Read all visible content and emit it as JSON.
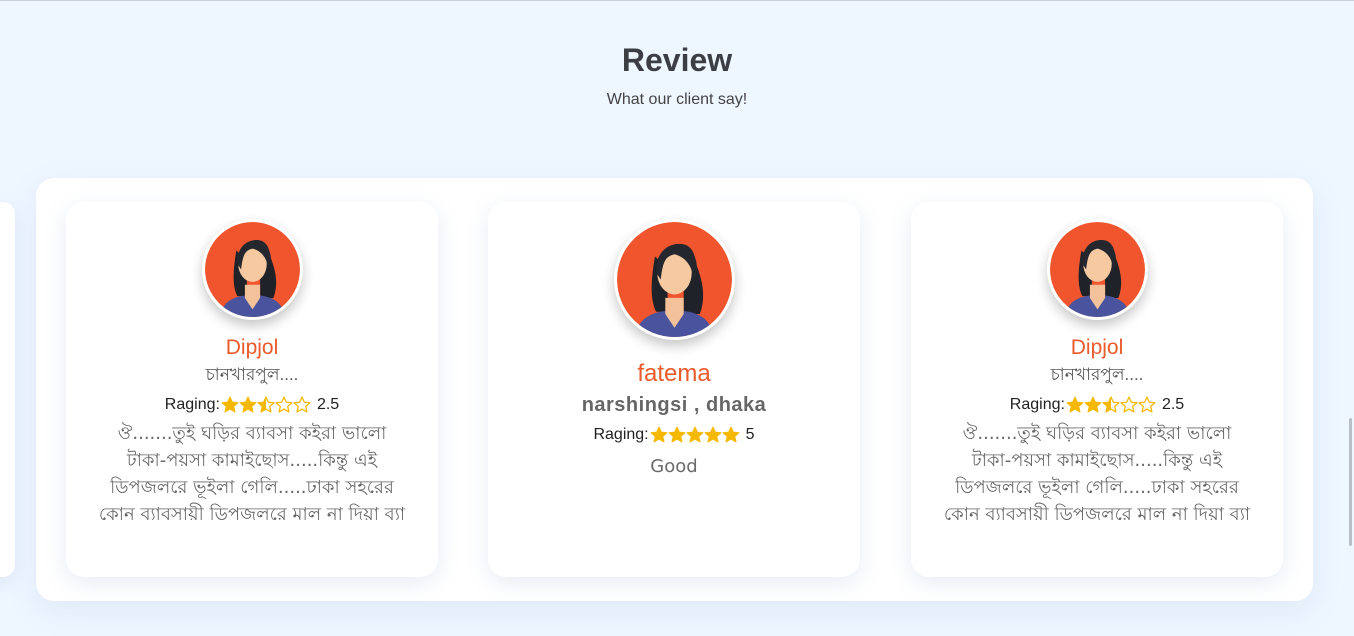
{
  "header": {
    "title": "Review",
    "subtitle": "What our client say!"
  },
  "reviews": [
    {
      "name": "Dipjol",
      "location": "চানখারপুল....",
      "rating_label": "Raging:",
      "rating_value": "2.5",
      "rating": 2.5,
      "text": "ঔ.......তুই ঘড়ির ব্যাবসা কইরা ভালো টাকা-পয়সা কামাইছোস.....কিন্তু এই ডিপজলরে ভূইলা গেলি.....ঢাকা সহরের কোন ব্যাবসায়ী ডিপজলরে মাল না দিয়া ব্যা"
    },
    {
      "name": "fatema",
      "location": "narshingsi , dhaka",
      "rating_label": "Raging:",
      "rating_value": "5",
      "rating": 5,
      "text": "Good"
    },
    {
      "name": "Dipjol",
      "location": "চানখারপুল....",
      "rating_label": "Raging:",
      "rating_value": "2.5",
      "rating": 2.5,
      "text": "ঔ.......তুই ঘড়ির ব্যাবসা কইরা ভালো টাকা-পয়সা কামাইছোস.....কিন্তু এই ডিপজলরে ভূইলা গেলি.....ঢাকা সহরের কোন ব্যাবসায়ী ডিপজলরে মাল না দিয়া ব্যা"
    }
  ],
  "colors": {
    "accent": "#ea5a2a",
    "star": "#f5b800",
    "background": "#eef6ff",
    "avatar_bg": "#f0552d"
  },
  "icons": {
    "avatar": "woman-avatar-icon",
    "star_full": "star-full-icon",
    "star_half": "star-half-icon",
    "star_empty": "star-empty-icon"
  }
}
